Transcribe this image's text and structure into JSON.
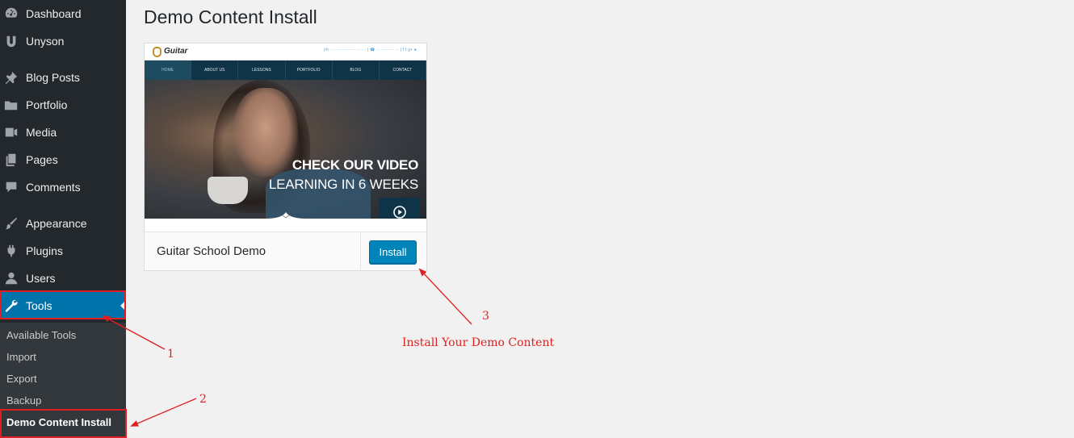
{
  "sidebar": {
    "items": [
      {
        "label": "Dashboard",
        "icon": "dashboard-icon"
      },
      {
        "label": "Unyson",
        "icon": "unyson-icon"
      },
      {
        "label": "Blog Posts",
        "icon": "pushpin-icon"
      },
      {
        "label": "Portfolio",
        "icon": "folder-icon"
      },
      {
        "label": "Media",
        "icon": "media-icon"
      },
      {
        "label": "Pages",
        "icon": "pages-icon"
      },
      {
        "label": "Comments",
        "icon": "comment-icon"
      },
      {
        "label": "Appearance",
        "icon": "brush-icon"
      },
      {
        "label": "Plugins",
        "icon": "plug-icon"
      },
      {
        "label": "Users",
        "icon": "user-icon"
      },
      {
        "label": "Tools",
        "icon": "wrench-icon",
        "active": true
      }
    ],
    "submenu": [
      {
        "label": "Available Tools"
      },
      {
        "label": "Import"
      },
      {
        "label": "Export"
      },
      {
        "label": "Backup"
      },
      {
        "label": "Demo Content Install",
        "current": true
      }
    ],
    "accent_color": "#0073aa",
    "background_color": "#23282d"
  },
  "main": {
    "title": "Demo Content Install",
    "demo": {
      "name": "Guitar School Demo",
      "install_label": "Install",
      "preview": {
        "logo": "Guitar",
        "nav": [
          "HOME",
          "ABOUT US",
          "LESSONS",
          "PORTFOLIO",
          "BLOG",
          "CONTACT"
        ],
        "headline": "CHECK OUR VIDEO",
        "subheadline": "LEARNING IN 6 WEEKS"
      }
    }
  },
  "annotations": {
    "color": "#e02020",
    "step1": "1",
    "step2": "2",
    "step3": "3",
    "step3_caption": "Install Your Demo Content"
  }
}
